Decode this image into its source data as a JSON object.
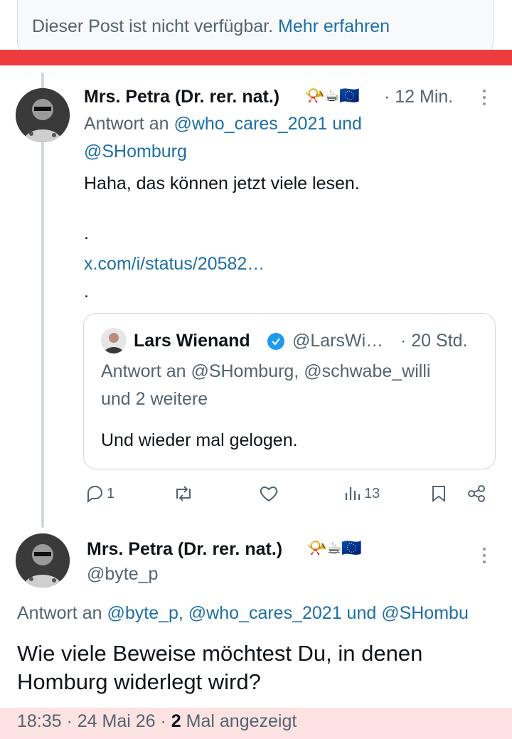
{
  "banner": {
    "text": "Dieser Post ist nicht verfügbar.",
    "link": "Mehr erfahren"
  },
  "reply1": {
    "author": "Mrs. Petra (Dr. rer. nat.)",
    "emojis": "📯☕🇪🇺",
    "time": "· 12 Min.",
    "reply_prefix": "Antwort an",
    "reply_to_line1": "@who_cares_2021 und",
    "reply_to_line2": "@SHomburg",
    "text": "Haha, das können jetzt viele lesen.",
    "dot1": ".",
    "url": "x.com/i/status/20582…",
    "dot2": ".",
    "quote": {
      "author": "Lars Wienand",
      "handle": "@LarsWi…",
      "time": "· 20 Std.",
      "reply_line1": "Antwort an @SHomburg, @schwabe_willi",
      "reply_line2": "und 2 weitere",
      "text": "Und wieder mal gelogen."
    },
    "actions": {
      "replies": "1",
      "views": "13"
    }
  },
  "main": {
    "author": "Mrs. Petra (Dr. rer. nat.)",
    "emojis": "📯☕🇪🇺",
    "handle": "@byte_p",
    "reply_prefix": "Antwort an",
    "reply_to": "@byte_p, @who_cares_2021 und @SHombu",
    "text_line1": "Wie viele Beweise möchtest Du, in denen",
    "text_line2": "Homburg widerlegt wird?",
    "footer": {
      "time": "18:35 · 24 Mai 26 ·",
      "count": "2",
      "suffix": "Mal angezeigt"
    }
  },
  "colors": {
    "accent": "#1d6fa5",
    "highlight_red": "#ee3c3c",
    "verified": "#1d9bf0"
  }
}
